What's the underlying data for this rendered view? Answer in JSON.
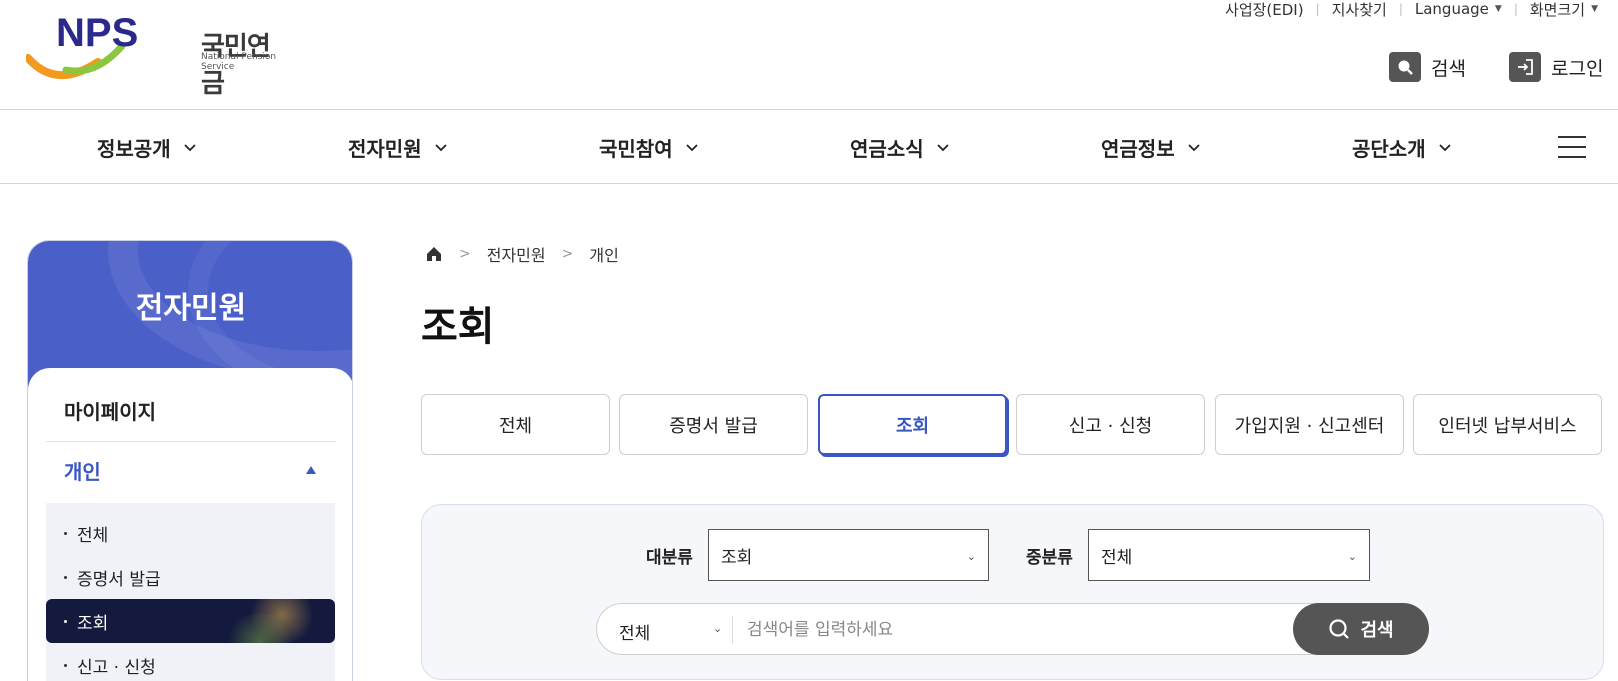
{
  "header": {
    "logo_mark": "NPS",
    "logo_text": "국민연금",
    "logo_sub": "National Pension Service",
    "util_links": [
      "사업장(EDI)",
      "지사찾기",
      "Language",
      "화면크기"
    ],
    "search_label": "검색",
    "login_label": "로그인"
  },
  "gnb": {
    "items": [
      "정보공개",
      "전자민원",
      "국민참여",
      "연금소식",
      "연금정보",
      "공단소개"
    ]
  },
  "sidebar": {
    "title": "전자민원",
    "mypage": "마이페이지",
    "section": "개인",
    "sub_items": [
      "전체",
      "증명서 발급",
      "조회",
      "신고 · 신청"
    ],
    "active_index": 2
  },
  "breadcrumb": [
    "전자민원",
    "개인"
  ],
  "page_title": "조회",
  "tabs": [
    "전체",
    "증명서 발급",
    "조회",
    "신고 · 신청",
    "가입지원 · 신고센터",
    "인터넷 납부서비스"
  ],
  "search": {
    "major_label": "대분류",
    "major_value": "조회",
    "minor_label": "중분류",
    "minor_value": "전체",
    "scope_value": "전체",
    "placeholder": "검색어를 입력하세요",
    "button_label": "검색"
  },
  "colors": {
    "brand_blue": "#3b57c4",
    "sidebar_header": "#4a5fc8",
    "active_dark": "#141a3e"
  }
}
